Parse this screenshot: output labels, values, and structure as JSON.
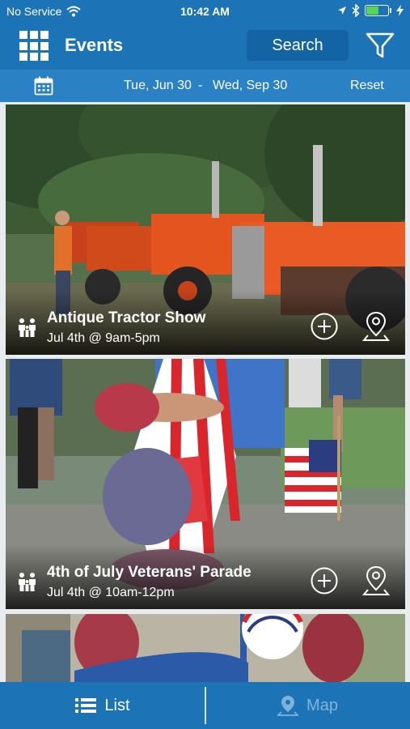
{
  "status_bar": {
    "carrier": "No Service",
    "time": "10:42 AM",
    "battery_level": 0.6,
    "icons": [
      "wifi-icon",
      "location-arrow-icon",
      "bluetooth-icon",
      "battery-icon",
      "charging-bolt-icon"
    ]
  },
  "nav": {
    "title": "Events",
    "search_label": "Search",
    "icons": [
      "app-grid-icon",
      "filter-icon"
    ]
  },
  "date_range": {
    "start": "Tue, Jun 30",
    "separator": "-",
    "end": "Wed, Sep 30",
    "reset_label": "Reset",
    "icon": "calendar-icon"
  },
  "events": [
    {
      "title": "Antique Tractor Show",
      "time": "Jul 4th @ 9am-5pm",
      "icons": [
        "family-icon",
        "add-circle-icon",
        "map-pin-icon"
      ]
    },
    {
      "title": "4th of July Veterans' Parade",
      "time": "Jul 4th @ 10am-12pm",
      "icons": [
        "family-icon",
        "add-circle-icon",
        "map-pin-icon"
      ]
    },
    {
      "title": "",
      "time": "",
      "icons": []
    }
  ],
  "tabs": [
    {
      "label": "List",
      "icon": "list-icon",
      "active": true
    },
    {
      "label": "Map",
      "icon": "map-marker-icon",
      "active": false
    }
  ],
  "colors": {
    "primary": "#1c74b6",
    "date_bar": "#2a82c4",
    "search_button": "#1463a3"
  }
}
